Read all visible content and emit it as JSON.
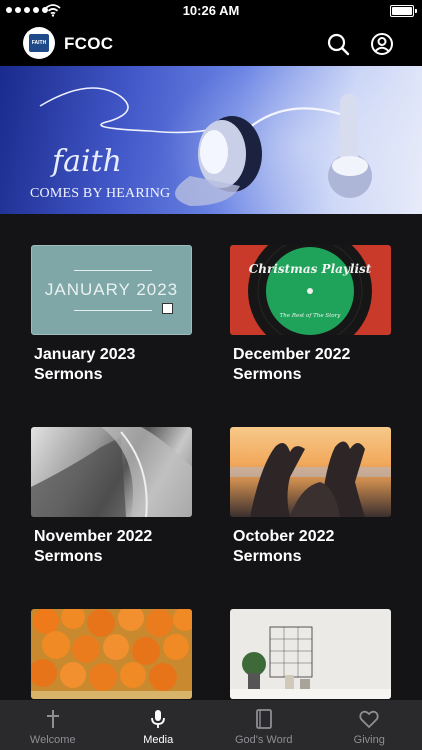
{
  "status_bar": {
    "time": "10:26 AM"
  },
  "header": {
    "title": "FCOC",
    "logo_text": "FAITH"
  },
  "banner": {
    "word": "faith",
    "subtitle": "COMES BY HEARING"
  },
  "cards": [
    {
      "title": "January 2023 Sermons",
      "thumb_text": "JANUARY 2023"
    },
    {
      "title": "December 2022 Sermons",
      "thumb_text": "Christmas Playlist",
      "thumb_sub": "The Rest of The Story"
    },
    {
      "title": "November 2022 Sermons"
    },
    {
      "title": "October 2022 Sermons"
    },
    {
      "title": ""
    },
    {
      "title": ""
    }
  ],
  "tabs": [
    {
      "label": "Welcome",
      "icon": "cross-icon",
      "active": false
    },
    {
      "label": "Media",
      "icon": "microphone-icon",
      "active": true
    },
    {
      "label": "God's Word",
      "icon": "book-icon",
      "active": false
    },
    {
      "label": "Giving",
      "icon": "heart-icon",
      "active": false
    }
  ],
  "colors": {
    "background": "#141416",
    "tab_bar": "#2a2a2c",
    "active_tab": "#ffffff",
    "inactive_tab": "#8e8e93"
  }
}
